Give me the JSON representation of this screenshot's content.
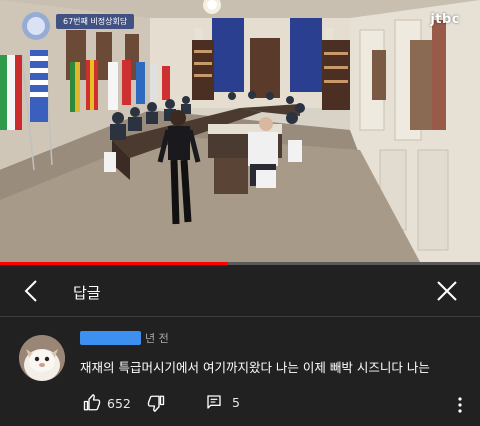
{
  "video": {
    "title_caption": "67번째 비정상회담",
    "channel_logo": "jtbc",
    "progress_fraction": 0.476
  },
  "reply_panel": {
    "title": "답글",
    "back_icon": "chevron-left-icon",
    "close_icon": "close-icon"
  },
  "comment": {
    "author_hidden": true,
    "timestamp": "년 전",
    "text": "재재의 특급머시기에서 여기까지왔다 나는 이제 빼박 시즈니다 나는",
    "likes": "652",
    "replies": "5",
    "like_icon": "thumb-up-icon",
    "dislike_icon": "thumb-down-icon",
    "reply_icon": "comment-icon",
    "more_icon": "more-vert-icon"
  },
  "colors": {
    "background": "#212121",
    "progress": "#ff0000",
    "redaction": "#3d8ff0"
  }
}
